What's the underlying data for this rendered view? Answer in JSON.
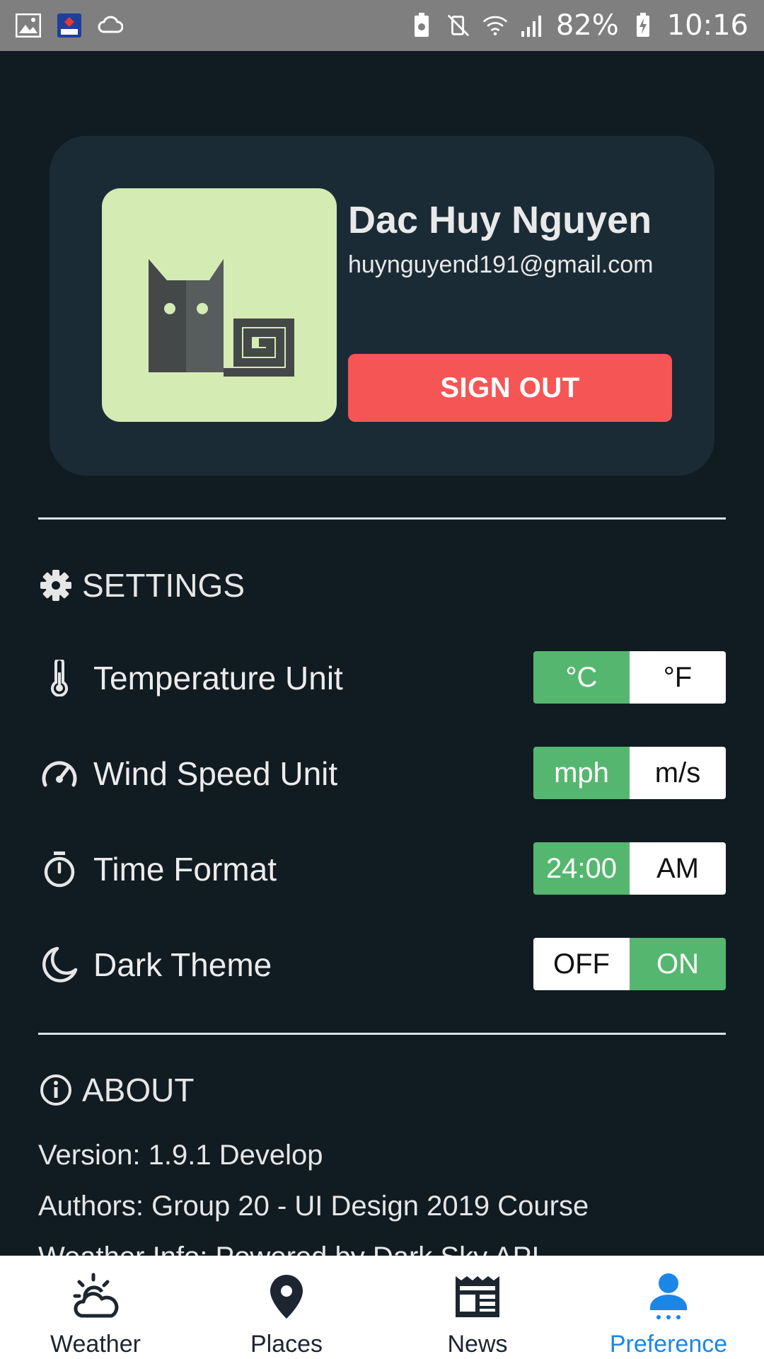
{
  "status_bar": {
    "battery": "82%",
    "time": "10:16",
    "left_icons": [
      "image-icon",
      "bidv-app-icon",
      "cloud-sync-icon"
    ],
    "right_icons": [
      "battery-saver-icon",
      "vibrate-mute-icon",
      "wifi-icon",
      "signal-icon",
      "battery-charging-icon"
    ]
  },
  "profile": {
    "name": "Dac Huy Nguyen",
    "email": "huynguyend191@gmail.com",
    "sign_out_label": "SIGN OUT"
  },
  "settings": {
    "title": "SETTINGS",
    "rows": [
      {
        "label": "Temperature Unit",
        "icon": "thermometer-icon",
        "options": [
          "°C",
          "°F"
        ],
        "selected": 0
      },
      {
        "label": "Wind Speed Unit",
        "icon": "speedometer-icon",
        "options": [
          "mph",
          "m/s"
        ],
        "selected": 0
      },
      {
        "label": "Time Format",
        "icon": "stopwatch-icon",
        "options": [
          "24:00",
          "AM"
        ],
        "selected": 0
      },
      {
        "label": "Dark Theme",
        "icon": "moon-icon",
        "options": [
          "OFF",
          "ON"
        ],
        "selected": 1
      }
    ]
  },
  "about": {
    "title": "ABOUT",
    "version": "Version: 1.9.1 Develop",
    "authors": "Authors: Group 20 - UI Design 2019 Course",
    "weather_info": "Weather Info: Powered by Dark Sky API"
  },
  "bottom_nav": {
    "items": [
      {
        "label": "Weather",
        "icon": "weather-icon"
      },
      {
        "label": "Places",
        "icon": "map-pin-icon"
      },
      {
        "label": "News",
        "icon": "newspaper-icon"
      },
      {
        "label": "Preference",
        "icon": "person-icon"
      }
    ],
    "active": 3
  },
  "colors": {
    "background": "#111c22",
    "card": "#1b2b36",
    "sign_out": "#f65556",
    "toggle_active": "#55b76f",
    "nav_active": "#1a86e8"
  }
}
